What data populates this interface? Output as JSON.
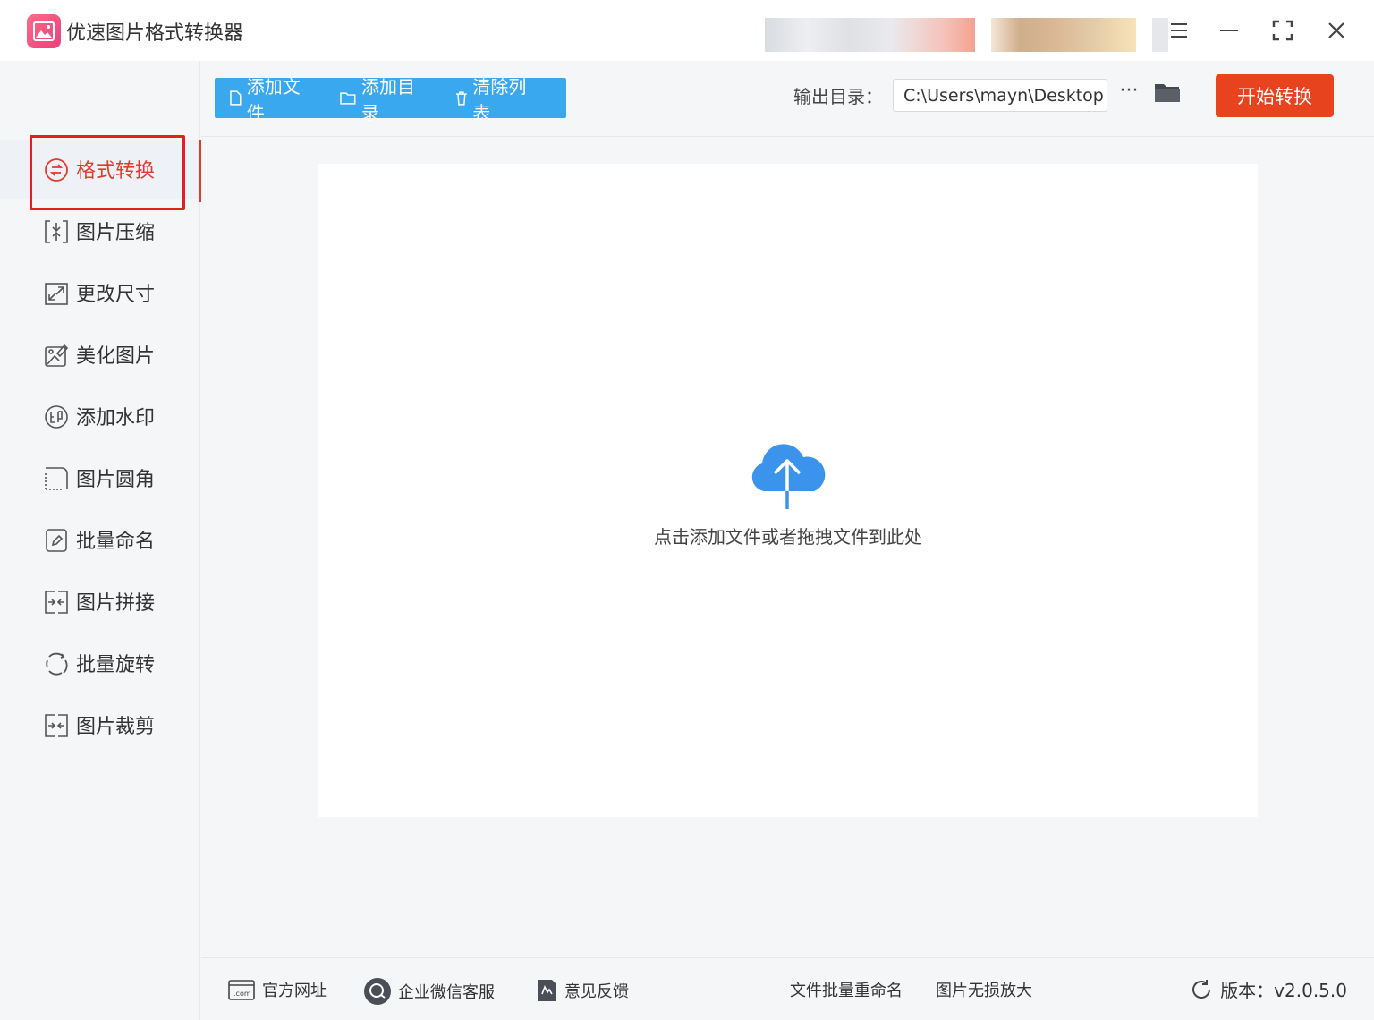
{
  "app": {
    "title": "优速图片格式转换器",
    "accent_color": "#e8431f",
    "primary_color": "#3aa8ee"
  },
  "titlebar": {
    "icons": [
      "menu-icon",
      "minimize-icon",
      "maximize-icon",
      "close-icon"
    ]
  },
  "sidebar": {
    "items": [
      {
        "label": "格式转换",
        "icon": "convert-icon",
        "active": true
      },
      {
        "label": "图片压缩",
        "icon": "compress-icon"
      },
      {
        "label": "更改尺寸",
        "icon": "resize-icon"
      },
      {
        "label": "美化图片",
        "icon": "beautify-icon"
      },
      {
        "label": "添加水印",
        "icon": "watermark-icon"
      },
      {
        "label": "图片圆角",
        "icon": "rounded-corner-icon"
      },
      {
        "label": "批量命名",
        "icon": "rename-icon"
      },
      {
        "label": "图片拼接",
        "icon": "splice-icon"
      },
      {
        "label": "批量旋转",
        "icon": "rotate-icon"
      },
      {
        "label": "图片裁剪",
        "icon": "crop-icon"
      }
    ]
  },
  "toolbar": {
    "add_file": "添加文件",
    "add_folder": "添加目录",
    "clear_list": "清除列表",
    "output_label": "输出目录：",
    "output_path": "C:\\Users\\mayn\\Desktop",
    "more": "···",
    "start": "开始转换"
  },
  "main": {
    "drop_hint": "点击添加文件或者拖拽文件到此处"
  },
  "footer": {
    "website": "官方网址",
    "wechat": "企业微信客服",
    "feedback": "意见反馈",
    "batch_rename": "文件批量重命名",
    "upscale": "图片无损放大",
    "version": "版本：v2.0.5.0"
  }
}
